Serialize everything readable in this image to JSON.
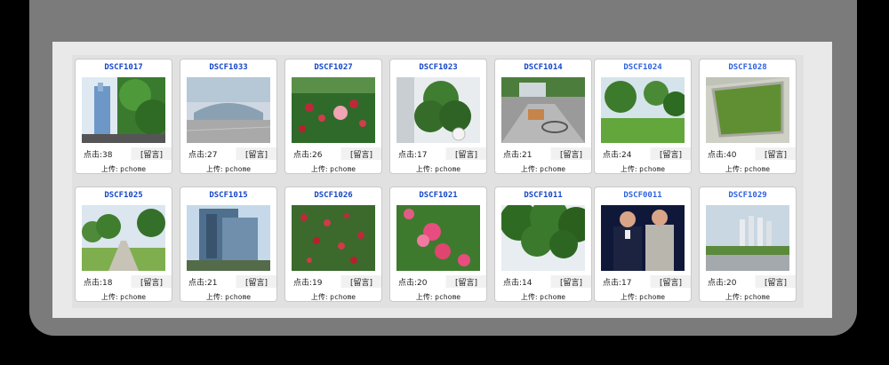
{
  "labels": {
    "clicks_prefix": "点击:",
    "message": "[留言]",
    "uploader_prefix": "上传:",
    "uploader_name": "pchome"
  },
  "photos": [
    {
      "title": "DSCF1017",
      "clicks": "38"
    },
    {
      "title": "DSCF1033",
      "clicks": "27"
    },
    {
      "title": "DSCF1027",
      "clicks": "26"
    },
    {
      "title": "DSCF1023",
      "clicks": "17"
    },
    {
      "title": "DSCF1014",
      "clicks": "21"
    },
    {
      "title": "DSCF1024",
      "clicks": "24"
    },
    {
      "title": "DSCF1028",
      "clicks": "40"
    },
    {
      "title": "DSCF1025",
      "clicks": "18"
    },
    {
      "title": "DSCF1015",
      "clicks": "21"
    },
    {
      "title": "DSCF1026",
      "clicks": "19"
    },
    {
      "title": "DSCF1021",
      "clicks": "20"
    },
    {
      "title": "DSCF1011",
      "clicks": "14"
    },
    {
      "title": "DSCF0011",
      "clicks": "17"
    },
    {
      "title": "DSCF1029",
      "clicks": "20"
    }
  ]
}
